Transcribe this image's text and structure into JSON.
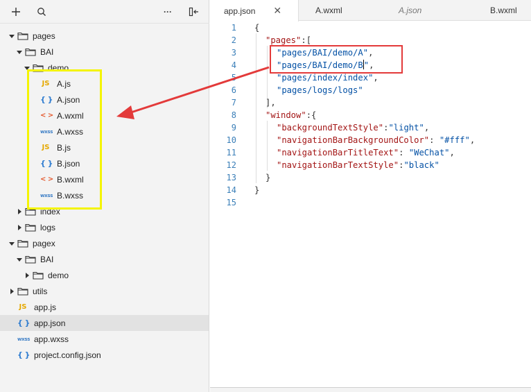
{
  "sidebar": {
    "toolbar": {
      "add_icon": "plus-icon",
      "search_icon": "search-icon",
      "more_label": "···",
      "collapse_icon": "collapse-panel-icon"
    },
    "tree": [
      {
        "label": "pages",
        "type": "folder",
        "expanded": true,
        "depth": 0
      },
      {
        "label": "BAI",
        "type": "folder",
        "expanded": true,
        "depth": 1
      },
      {
        "label": "demo",
        "type": "folder",
        "expanded": true,
        "depth": 2
      },
      {
        "label": "A.js",
        "type": "js",
        "depth": 3
      },
      {
        "label": "A.json",
        "type": "json",
        "depth": 3
      },
      {
        "label": "A.wxml",
        "type": "wxml",
        "depth": 3
      },
      {
        "label": "A.wxss",
        "type": "wxss",
        "depth": 3
      },
      {
        "label": "B.js",
        "type": "js",
        "depth": 3
      },
      {
        "label": "B.json",
        "type": "json",
        "depth": 3
      },
      {
        "label": "B.wxml",
        "type": "wxml",
        "depth": 3
      },
      {
        "label": "B.wxss",
        "type": "wxss",
        "depth": 3
      },
      {
        "label": "index",
        "type": "folder",
        "expanded": false,
        "depth": 1
      },
      {
        "label": "logs",
        "type": "folder",
        "expanded": false,
        "depth": 1
      },
      {
        "label": "pagex",
        "type": "folder",
        "expanded": true,
        "depth": 0
      },
      {
        "label": "BAI",
        "type": "folder",
        "expanded": true,
        "depth": 1
      },
      {
        "label": "demo",
        "type": "folder",
        "expanded": false,
        "depth": 2
      },
      {
        "label": "utils",
        "type": "folder",
        "expanded": false,
        "depth": 0
      },
      {
        "label": "app.js",
        "type": "js",
        "depth": 0
      },
      {
        "label": "app.json",
        "type": "json",
        "depth": 0,
        "selected": true
      },
      {
        "label": "app.wxss",
        "type": "wxss",
        "depth": 0
      },
      {
        "label": "project.config.json",
        "type": "json",
        "depth": 0
      }
    ],
    "file_icon_glyphs": {
      "js": "JS",
      "json": "{ }",
      "wxml": "< >",
      "wxss": "wxss"
    }
  },
  "editor": {
    "tabs": [
      {
        "label": "app.json",
        "active": true,
        "close": "✕"
      },
      {
        "label": "A.wxml",
        "active": false
      },
      {
        "label": "A.json",
        "active": false,
        "italic": true
      },
      {
        "label": "B.wxml",
        "active": false
      }
    ],
    "lines": [
      {
        "n": "1",
        "indent": 0,
        "parts": [
          {
            "t": "{",
            "c": "p"
          }
        ]
      },
      {
        "n": "2",
        "indent": 1,
        "parts": [
          {
            "t": "\"pages\"",
            "c": "k"
          },
          {
            "t": ":[",
            "c": "p"
          }
        ]
      },
      {
        "n": "3",
        "indent": 2,
        "parts": [
          {
            "t": "\"pages/BAI/demo/A\"",
            "c": "s"
          },
          {
            "t": ",",
            "c": "p"
          }
        ]
      },
      {
        "n": "4",
        "indent": 2,
        "parts": [
          {
            "t": "\"pages/BAI/demo/B",
            "c": "s"
          },
          {
            "t": "|",
            "c": "cursor"
          },
          {
            "t": "\"",
            "c": "s"
          },
          {
            "t": ",",
            "c": "p"
          }
        ]
      },
      {
        "n": "5",
        "indent": 2,
        "parts": [
          {
            "t": "\"pages/index/index\"",
            "c": "s"
          },
          {
            "t": ",",
            "c": "p"
          }
        ]
      },
      {
        "n": "6",
        "indent": 2,
        "parts": [
          {
            "t": "\"pages/logs/logs\"",
            "c": "s"
          }
        ]
      },
      {
        "n": "7",
        "indent": 1,
        "parts": [
          {
            "t": "],",
            "c": "p"
          }
        ]
      },
      {
        "n": "8",
        "indent": 1,
        "parts": [
          {
            "t": "\"window\"",
            "c": "k"
          },
          {
            "t": ":{",
            "c": "p"
          }
        ]
      },
      {
        "n": "9",
        "indent": 2,
        "parts": [
          {
            "t": "\"backgroundTextStyle\"",
            "c": "k"
          },
          {
            "t": ":",
            "c": "p"
          },
          {
            "t": "\"light\"",
            "c": "s"
          },
          {
            "t": ",",
            "c": "p"
          }
        ]
      },
      {
        "n": "10",
        "indent": 2,
        "parts": [
          {
            "t": "\"navigationBarBackgroundColor\"",
            "c": "k"
          },
          {
            "t": ": ",
            "c": "p"
          },
          {
            "t": "\"#fff\"",
            "c": "s"
          },
          {
            "t": ",",
            "c": "p"
          }
        ]
      },
      {
        "n": "11",
        "indent": 2,
        "parts": [
          {
            "t": "\"navigationBarTitleText\"",
            "c": "k"
          },
          {
            "t": ": ",
            "c": "p"
          },
          {
            "t": "\"WeChat\"",
            "c": "s"
          },
          {
            "t": ",",
            "c": "p"
          }
        ]
      },
      {
        "n": "12",
        "indent": 2,
        "parts": [
          {
            "t": "\"navigationBarTextStyle\"",
            "c": "k"
          },
          {
            "t": ":",
            "c": "p"
          },
          {
            "t": "\"black\"",
            "c": "s"
          }
        ]
      },
      {
        "n": "13",
        "indent": 1,
        "parts": [
          {
            "t": "}",
            "c": "p"
          }
        ]
      },
      {
        "n": "14",
        "indent": 0,
        "parts": [
          {
            "t": "}",
            "c": "p"
          }
        ]
      },
      {
        "n": "15",
        "indent": 0,
        "parts": []
      }
    ]
  },
  "colors": {
    "annotation_yellow": "#f4f400",
    "annotation_red": "#e33a3a",
    "json_key": "#a31515",
    "json_string": "#0451a5",
    "line_number": "#3b7fb8"
  }
}
